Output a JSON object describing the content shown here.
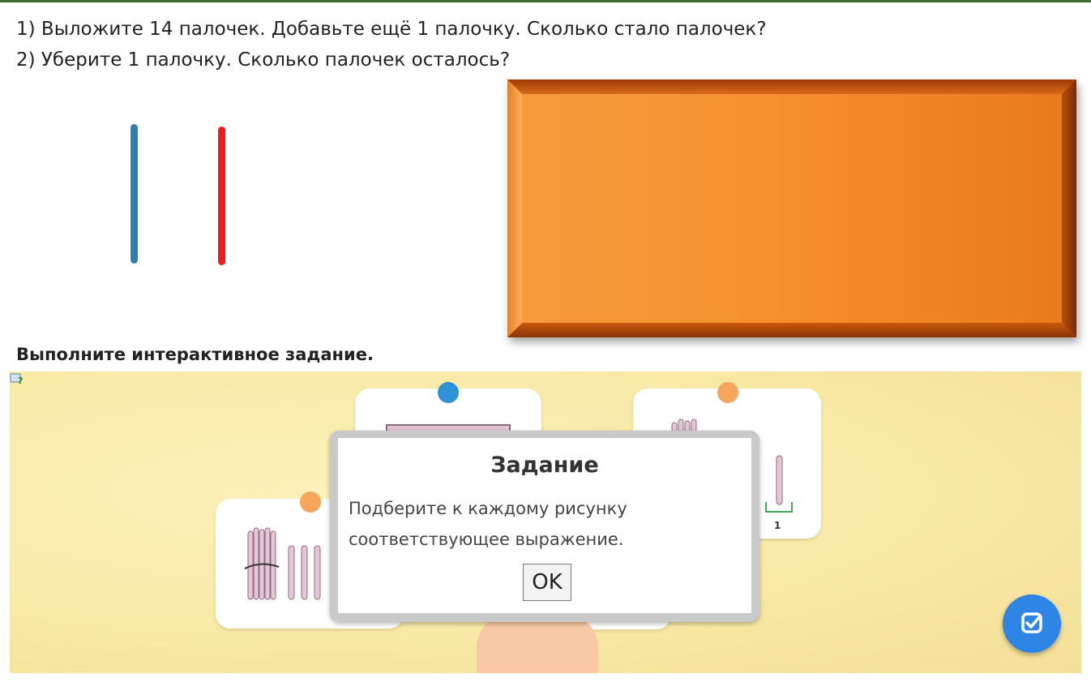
{
  "questions": {
    "line1": "1) Выложите 14 палочек. Добавьте ещё 1 палочку. Сколько стало палочек?",
    "line2": "2) Уберите 1 палочку. Сколько палочек осталось?"
  },
  "sticks": [
    {
      "color": "#2e7fb1"
    },
    {
      "color": "#f21b1b"
    }
  ],
  "board": {
    "color": "#f4922d"
  },
  "section_title": "Выполните интерактивное задание.",
  "activity": {
    "help_icon": "help-icon",
    "card_label_1": "1",
    "dialog": {
      "title": "Задание",
      "text": "Подберите к каждому рисунку соответствующее выражение.",
      "ok_label": "OK"
    },
    "check_button_icon": "check-icon"
  }
}
